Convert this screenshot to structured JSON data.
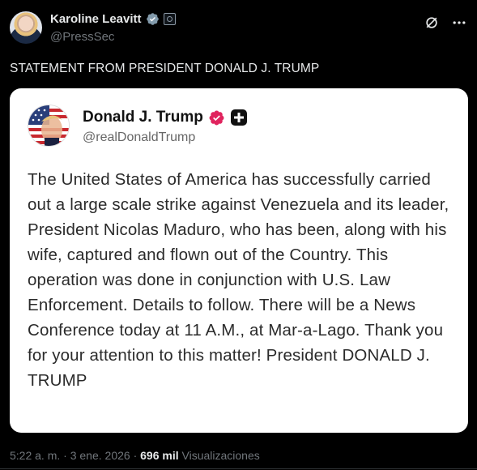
{
  "post": {
    "author": {
      "display_name": "Karoline Leavitt",
      "handle": "@PressSec",
      "verified_badge_color": "#829aab",
      "affiliation_badge": "government-affiliation-icon"
    },
    "text": "STATEMENT FROM PRESIDENT DONALD J. TRUMP",
    "actions": {
      "grok_icon": "grok-icon",
      "more_icon": "more-options-icon"
    },
    "embedded": {
      "author": {
        "display_name": "Donald J. Trump",
        "handle": "@realDonaldTrump",
        "verified_badge_color": "#e0245e",
        "platform_badge": "truth-social-plus-icon"
      },
      "body": "The United States of America has successfully carried out a large scale strike against Venezuela and its leader, President Nicolas Maduro, who has been, along with his wife, captured and flown out of the Country. This operation was done in conjunction with U.S. Law Enforcement. Details to follow. There will be a News Conference today at 11 A.M., at Mar-a-Lago. Thank you for your attention to this matter! President DONALD J. TRUMP"
    },
    "meta": {
      "time": "5:22 a. m.",
      "separator": " · ",
      "date": "3 ene. 2026",
      "views_count": "696 mil",
      "views_label": "Visualizaciones"
    }
  },
  "colors": {
    "background": "#000000",
    "text_primary": "#e7e9ea",
    "text_secondary": "#71767b",
    "card_background": "#ffffff"
  }
}
